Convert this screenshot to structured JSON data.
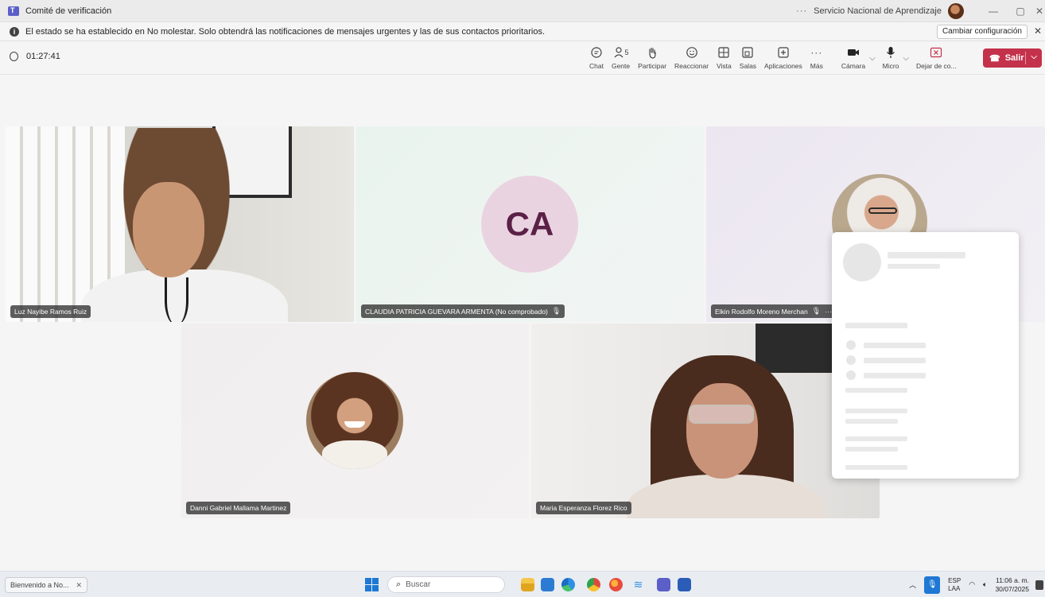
{
  "window": {
    "title": "Comité de verificación",
    "organization": "Servicio Nacional de Aprendizaje",
    "more_glyph": "···",
    "minimize_glyph": "—",
    "restore_glyph": "▢",
    "close_glyph": "✕"
  },
  "notification": {
    "message": "El estado se ha establecido en No molestar. Solo obtendrá las notificaciones de mensajes urgentes y las de sus contactos prioritarios.",
    "button_label": "Cambiar configuración",
    "close_glyph": "✕"
  },
  "meeting": {
    "elapsed": "01:27:41",
    "people_count": "5",
    "tools": {
      "chat": "Chat",
      "people": "Gente",
      "raise": "Participar",
      "react": "Reaccionar",
      "view": "Vista",
      "rooms": "Salas",
      "apps": "Aplicaciones",
      "more": "Más",
      "camera": "Cámara",
      "mic": "Micro",
      "share": "Dejar de co...",
      "leave": "Salir"
    }
  },
  "participants": [
    {
      "name": "Luz Nayibe Ramos Ruiz"
    },
    {
      "name": "CLAUDIA PATRICIA GUEVARA ARMENTA (No comprobado)",
      "initials": "CA"
    },
    {
      "name": "Elkin Rodolfo Moreno Merchan"
    },
    {
      "name": "Danni Gabriel Mallama Martinez"
    },
    {
      "name": "Maria Esperanza Florez Rico"
    }
  ],
  "taskbar": {
    "app_label": "Bienvenido a No...",
    "app_close_glyph": "✕",
    "search_placeholder": "Buscar",
    "lang_top": "ESP",
    "lang_bottom": "LAA",
    "time": "11:06 a. m.",
    "date": "30/07/2025"
  },
  "colors": {
    "leave_button": "#c4314b",
    "teams_brand": "#5b5fc7",
    "ca_avatar_bg": "#ead3e1",
    "ca_avatar_text": "#5b2046"
  }
}
